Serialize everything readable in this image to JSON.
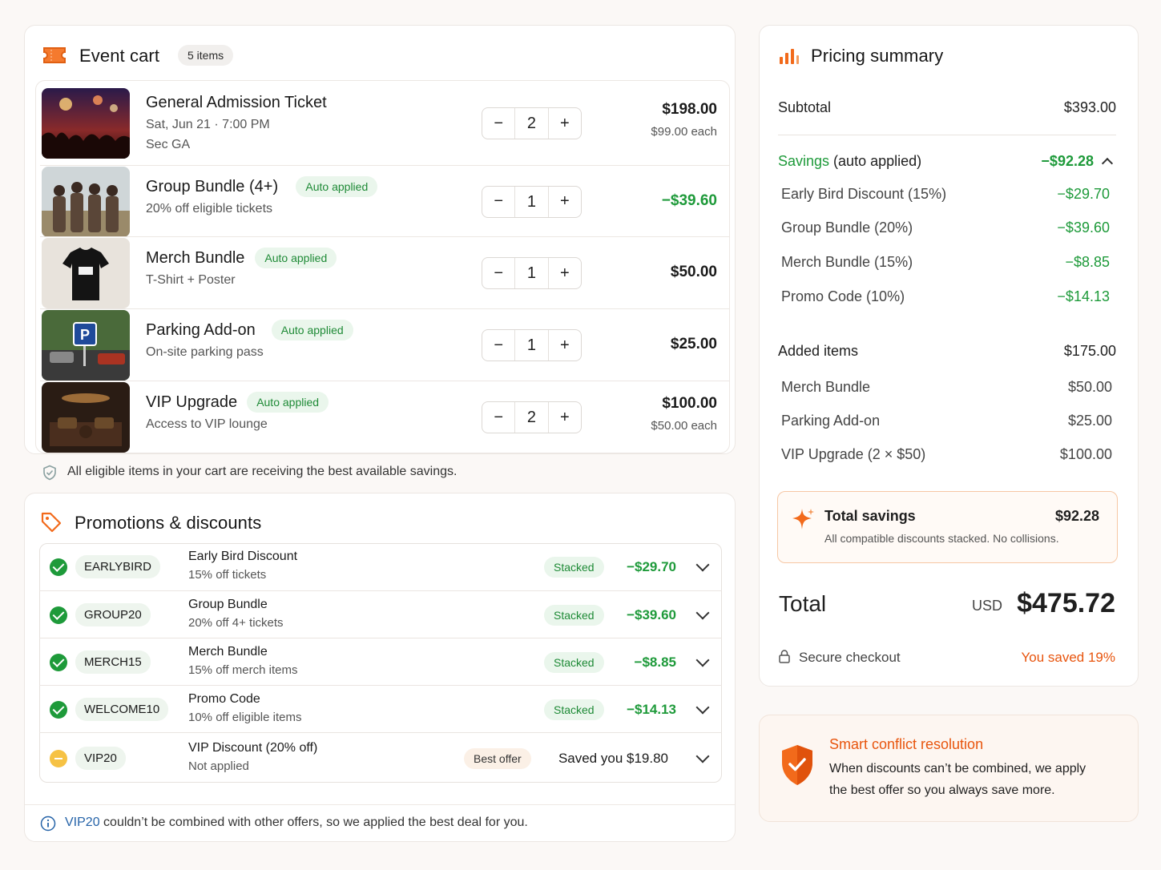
{
  "cart": {
    "title": "Event cart",
    "count_badge": "5 items",
    "items": [
      {
        "name": "General Admission Ticket",
        "line1": "Sat, Jun 21 · 7:00 PM",
        "line2": "Sec GA",
        "qty": "2",
        "price": "$198.00",
        "each": "$99.00 each",
        "badge": "",
        "image": "concert-crowd-photo"
      },
      {
        "name": "Group Bundle (4+)",
        "line1": "20% off eligible tickets",
        "line2": "",
        "qty": "1",
        "price": "−$39.60",
        "each": "",
        "badge": "Auto applied",
        "image": "group-of-people-photo"
      },
      {
        "name": "Merch Bundle",
        "line1": "T-Shirt + Poster",
        "line2": "",
        "qty": "1",
        "price": "$50.00",
        "each": "",
        "badge": "Auto applied",
        "image": "tshirt-photo"
      },
      {
        "name": "Parking Add-on",
        "line1": "On-site parking pass",
        "line2": "",
        "qty": "1",
        "price": "$25.00",
        "each": "",
        "badge": "Auto applied",
        "image": "parking-sign-photo"
      },
      {
        "name": "VIP Upgrade",
        "line1": "Access to VIP lounge",
        "line2": "",
        "qty": "2",
        "price": "$100.00",
        "each": "$50.00 each",
        "badge": "Auto applied",
        "image": "vip-lounge-photo"
      }
    ],
    "minus_label": "−",
    "plus_label": "+",
    "notice": "All eligible items in your cart are receiving the best available savings."
  },
  "promos": {
    "title": "Promotions & discounts",
    "rows": [
      {
        "code": "EARLYBIRD",
        "name": "Early Bird Discount",
        "desc": "15% off tickets",
        "status": "Stacked",
        "amount": "−$29.70",
        "state": "applied"
      },
      {
        "code": "GROUP20",
        "name": "Group Bundle",
        "desc": "20% off 4+ tickets",
        "status": "Stacked",
        "amount": "−$39.60",
        "state": "applied"
      },
      {
        "code": "MERCH15",
        "name": "Merch Bundle",
        "desc": "15% off merch items",
        "status": "Stacked",
        "amount": "−$8.85",
        "state": "applied"
      },
      {
        "code": "WELCOME10",
        "name": "Promo Code",
        "desc": "10% off eligible items",
        "status": "Stacked",
        "amount": "−$14.13",
        "state": "applied"
      },
      {
        "code": "VIP20",
        "name": "VIP Discount (20% off)",
        "desc": "Not applied",
        "status": "Best offer",
        "amount": "Saved you $19.80",
        "state": "not-applied"
      }
    ],
    "footer_code": "VIP20",
    "footer_text": " couldn’t be combined with other offers, so we applied the best deal for you."
  },
  "summary": {
    "title": "Pricing summary",
    "subtotal_label": "Subtotal",
    "subtotal_value": "$393.00",
    "savings_label_green": "Savings",
    "savings_label_rest": " (auto applied)",
    "savings_value": "−$92.28",
    "savings_items": [
      {
        "label": "Early Bird Discount (15%)",
        "value": "−$29.70"
      },
      {
        "label": "Group Bundle (20%)",
        "value": "−$39.60"
      },
      {
        "label": "Merch Bundle (15%)",
        "value": "−$8.85"
      },
      {
        "label": "Promo Code (10%)",
        "value": "−$14.13"
      }
    ],
    "added_label": "Added items",
    "added_value": "$175.00",
    "added_items": [
      {
        "label": "Merch Bundle",
        "value": "$50.00"
      },
      {
        "label": "Parking Add-on",
        "value": "$25.00"
      },
      {
        "label": "VIP Upgrade (2 × $50)",
        "value": "$100.00"
      }
    ],
    "total_savings_label": "Total savings",
    "total_savings_value": "$92.28",
    "total_savings_note": "All compatible discounts stacked. No collisions.",
    "total_label": "Total",
    "currency": "USD",
    "total_value": "$475.72",
    "secure_label": "Secure checkout",
    "saved_label": "You saved 19%"
  },
  "conflict": {
    "title": "Smart conflict resolution",
    "body_line1": "When discounts can’t be combined, we apply",
    "body_line2": "the best offer so you always save more."
  },
  "colors": {
    "accent": "#f26a1b",
    "green": "#1e9a3a",
    "blue": "#2563a8"
  }
}
